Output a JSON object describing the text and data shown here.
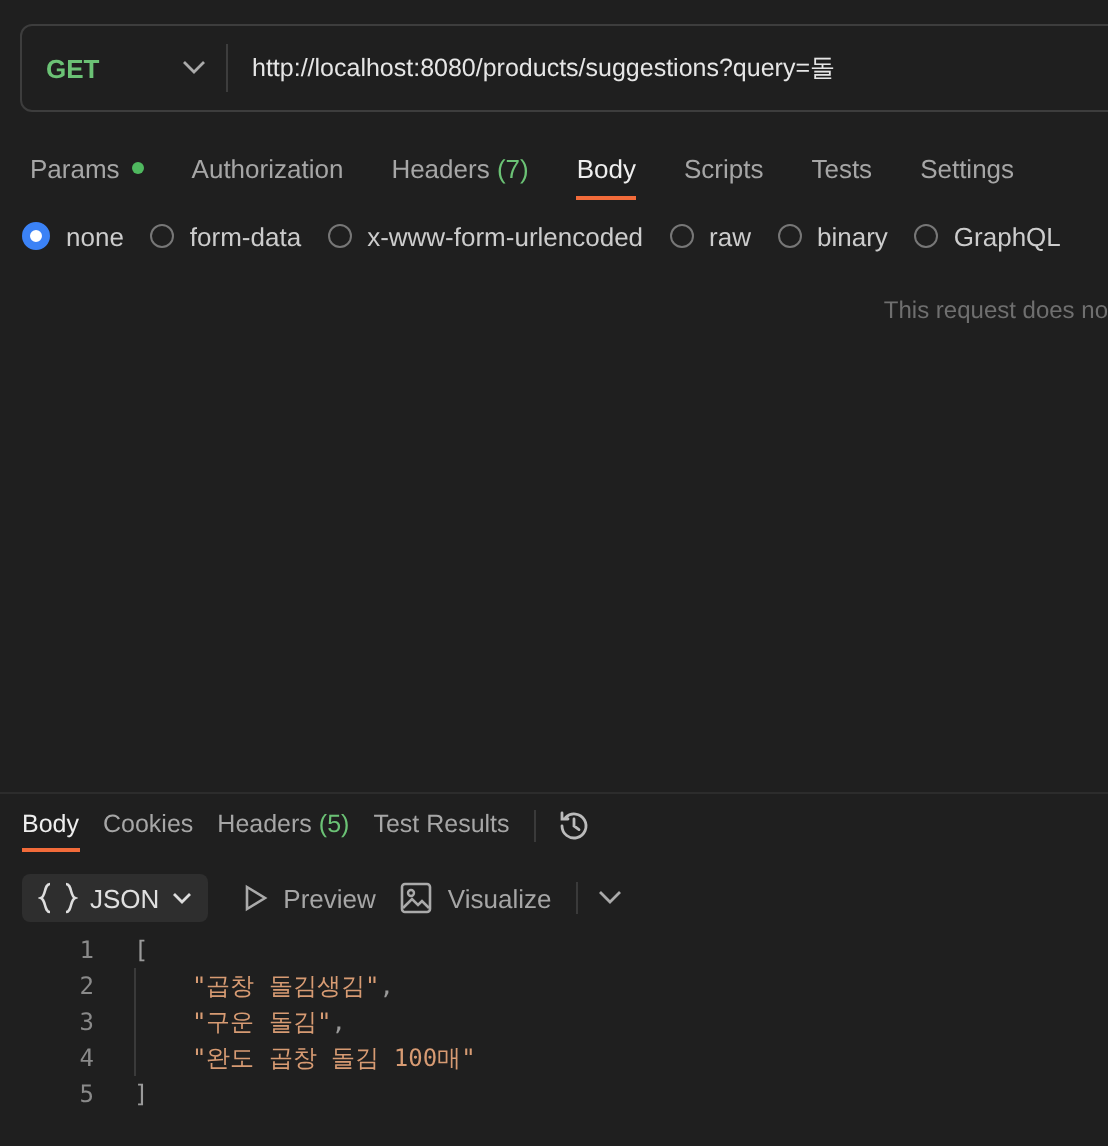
{
  "request": {
    "method": "GET",
    "url": "http://localhost:8080/products/suggestions?query=돌"
  },
  "request_tabs": [
    {
      "label": "Params",
      "dot": true,
      "selected": false
    },
    {
      "label": "Authorization",
      "dot": false,
      "selected": false
    },
    {
      "label": "Headers",
      "count": "(7)",
      "dot": false,
      "selected": false
    },
    {
      "label": "Body",
      "dot": false,
      "selected": true
    },
    {
      "label": "Scripts",
      "dot": false,
      "selected": false
    },
    {
      "label": "Tests",
      "dot": false,
      "selected": false
    },
    {
      "label": "Settings",
      "dot": false,
      "selected": false
    }
  ],
  "body_types": [
    {
      "label": "none",
      "selected": true
    },
    {
      "label": "form-data",
      "selected": false
    },
    {
      "label": "x-www-form-urlencoded",
      "selected": false
    },
    {
      "label": "raw",
      "selected": false
    },
    {
      "label": "binary",
      "selected": false
    },
    {
      "label": "GraphQL",
      "selected": false
    }
  ],
  "body_message": "This request does no",
  "response_tabs": [
    {
      "label": "Body",
      "selected": true
    },
    {
      "label": "Cookies",
      "selected": false
    },
    {
      "label": "Headers",
      "count": "(5)",
      "selected": false
    },
    {
      "label": "Test Results",
      "selected": false
    }
  ],
  "response_toolbar": {
    "format": "JSON",
    "preview": "Preview",
    "visualize": "Visualize"
  },
  "code_lines": [
    {
      "number": "1",
      "kind": "bracket",
      "text": "["
    },
    {
      "number": "2",
      "kind": "string",
      "text": "\"곱창 돌김생김\"",
      "punct": ","
    },
    {
      "number": "3",
      "kind": "string",
      "text": "\"구운 돌김\"",
      "punct": ","
    },
    {
      "number": "4",
      "kind": "string",
      "text": "\"완도 곱창 돌김 100매\""
    },
    {
      "number": "5",
      "kind": "bracket",
      "text": "]"
    }
  ]
}
